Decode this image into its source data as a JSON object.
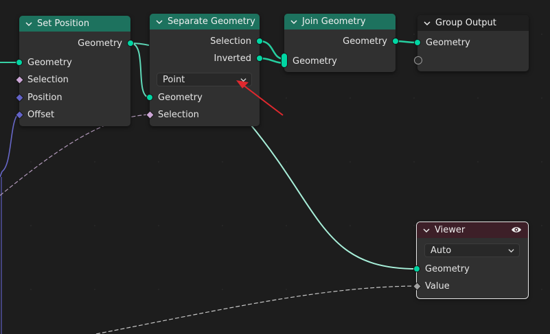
{
  "colors": {
    "geometry_node_header": "#1d725e",
    "output_node_header": "#1f1f1f",
    "viewer_node_header": "#3d1f28",
    "geometry_socket": "#00d6a3",
    "bool_socket": "#cca6d6",
    "vector_socket": "#6363c7",
    "float_socket": "#a1a1a1",
    "annotation_arrow": "#e0282e"
  },
  "nodes": {
    "set_position": {
      "title": "Set Position",
      "outputs": [
        "Geometry"
      ],
      "inputs": [
        "Geometry",
        "Selection",
        "Position",
        "Offset"
      ]
    },
    "separate_geometry": {
      "title": "Separate Geometry",
      "outputs": [
        "Selection",
        "Inverted"
      ],
      "domain_value": "Point",
      "inputs": [
        "Geometry",
        "Selection"
      ]
    },
    "join_geometry": {
      "title": "Join Geometry",
      "outputs": [
        "Geometry"
      ],
      "inputs": [
        "Geometry"
      ]
    },
    "group_output": {
      "title": "Group Output",
      "inputs": [
        "Geometry"
      ]
    },
    "viewer": {
      "title": "Viewer",
      "domain_value": "Auto",
      "inputs": [
        "Geometry",
        "Value"
      ]
    }
  }
}
